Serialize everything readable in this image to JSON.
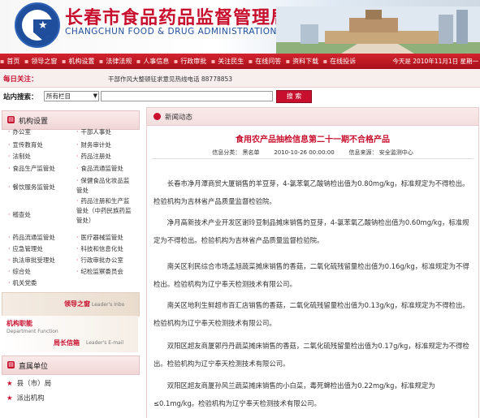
{
  "header": {
    "title_cn": "长春市食品药品监督管理局",
    "title_en": "CHANGCHUN FOOD & DRUG ADMINISTRATION",
    "logo_text": "FDA"
  },
  "nav": {
    "items": [
      "首页",
      "领导之窗",
      "机构设置",
      "法律法规",
      "人事信息",
      "行政审批",
      "关注民生",
      "在线问答",
      "资料下载",
      "在线投诉"
    ],
    "date": "今天是 2010年11月1日 星期一"
  },
  "notice": {
    "label": "每日关注：",
    "text": "干部作风大整顿征求意见热线电话 88778853"
  },
  "search": {
    "label": "站内搜索：",
    "select_value": "所有栏目",
    "input_value": "",
    "button_label": "搜 索"
  },
  "org_panel": {
    "title": "机构设置",
    "items": [
      "办公室",
      "干部人事处",
      "宣传教育处",
      "财务审计处",
      "法制处",
      "药品注册处",
      "食品生产监管处",
      "食品流通监管处",
      "餐饮服务监管处",
      "保健食品化妆品监管处",
      "稽查处",
      "药品注册和生产监管处（中药民族药监管处）",
      "药品流通监管处",
      "医疗器械监管处",
      "应急管理处",
      "科技和信息化处",
      "执法审批受理处",
      "行政审批办公室",
      "综合处",
      "纪检监察委员会",
      "机关党委"
    ]
  },
  "leader_box": {
    "title": "领导之窗",
    "subtitle": "Leader's Inbo"
  },
  "duty_box": {
    "title": "机构职能",
    "subtitle": "Department Function",
    "mail_title": "局长信箱",
    "mail_subtitle": "Leader's E-mail"
  },
  "direct_panel": {
    "title": "直属单位",
    "items": [
      "县（市）局",
      "派出机构"
    ]
  },
  "news": {
    "section_title": "新闻动态",
    "article_title": "食用农产品抽检信息第二十一期不合格产品",
    "meta": "信息分类： 黑名单        2010-10-26 00:00:00        信息来源： 安全监测中心",
    "paragraphs": [
      "长春市净月潭商贸大厦销售的羊豆芽，4-氯苯氧乙酸钠检出值为0.80mg/kg，标准规定为不得检出。检验机构为吉林省产品质量监督检验院。",
      "净月高新技术产业开发区谢玲豆制品摊床销售的豆芽，4-氯苯氧乙酸钠检出值为0.60mg/kg，标准规定为不得检出。检验机构为吉林省产品质量监督检验院。",
      "南关区利民综合市场孟旭蔬菜摊床销售的香菇，二氧化硫残留量检出值为0.16g/kg，标准规定为不得检出。检验机构为辽宁奉天检测技术有限公司。",
      "南关区地利生鲜超市百汇店销售的香菇，二氧化硫残留量检出值为0.13g/kg，标准规定为不得检出。检验机构为辽宁奉天检测技术有限公司。",
      "双阳区超友商厦郭丹丹蔬菜摊床销售的香菇，二氧化硫残留量检出值为0.17g/kg，标准规定为不得检出。检验机构为辽宁奉天检测技术有限公司。",
      "双阳区超友商厦孙风兰蔬菜摊床销售的小白菜，毒死蜱检出值为0.22mg/kg，标准规定为≤0.1mg/kg。检验机构为辽宁奉天检测技术有限公司。"
    ]
  },
  "colors": {
    "brand_red": "#c8102e",
    "brand_blue": "#1f4f9c"
  }
}
